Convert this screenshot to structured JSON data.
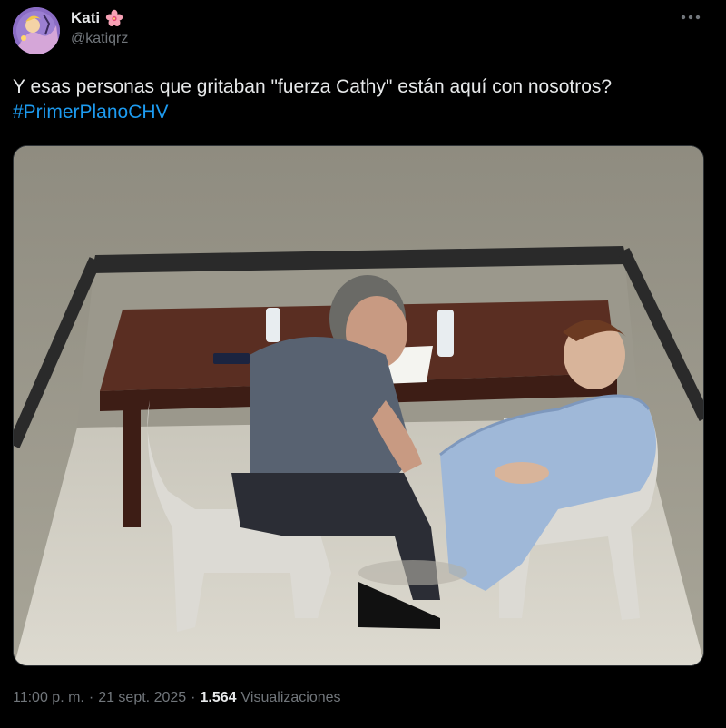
{
  "author": {
    "display_name": "Kati",
    "name_emoji": "flower-icon",
    "handle": "@katiqrz"
  },
  "tweet": {
    "text": "Y esas personas que gritaban \"fuerza Cathy\" están aquí con nosotros?",
    "hashtag": "#PrimerPlanoCHV",
    "image_icon": "interrogation-room-photo"
  },
  "meta": {
    "time": "11:00 p. m.",
    "separator1": "·",
    "date": "21 sept. 2025",
    "separator2": "·",
    "views_count": "1.564",
    "views_label": "Visualizaciones"
  },
  "menu": {
    "more_icon": "more-icon"
  },
  "colors": {
    "background": "#000000",
    "text": "#e7e9ea",
    "secondary_text": "#71767b",
    "link": "#1d9bf0"
  }
}
